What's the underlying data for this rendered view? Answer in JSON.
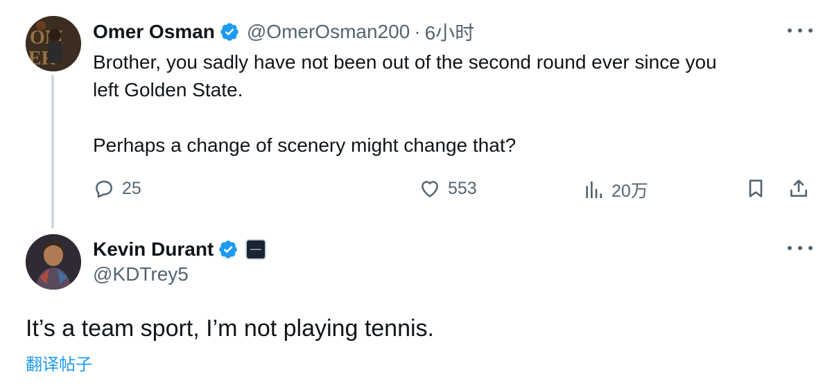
{
  "reply": {
    "author_name": "Omer Osman",
    "author_handle": "@OmerOsman200",
    "separator": "·",
    "time": "6小时",
    "text_lines": [
      "Brother, you sadly have not been out of the second round ever since you",
      "left Golden State.",
      "Perhaps a change of scenery might change that?"
    ],
    "stats": {
      "replies": "25",
      "likes": "553",
      "views": "20万"
    }
  },
  "main_tweet": {
    "author_name": "Kevin Durant",
    "author_handle": "@KDTrey5",
    "text": "It’s a team sport, I’m not playing tennis.",
    "translate_label": "翻译帖子"
  },
  "colors": {
    "verified": "#1d9bf0",
    "secondary_text": "#536471",
    "link": "#1d9bf0",
    "thread_line": "#cfd9de"
  },
  "icons": {
    "verified": "verified-badge-icon",
    "reply": "reply-bubble-icon",
    "like": "heart-icon",
    "views": "bar-chart-icon",
    "bookmark": "bookmark-icon",
    "share": "share-icon",
    "more": "more-dots-icon"
  }
}
